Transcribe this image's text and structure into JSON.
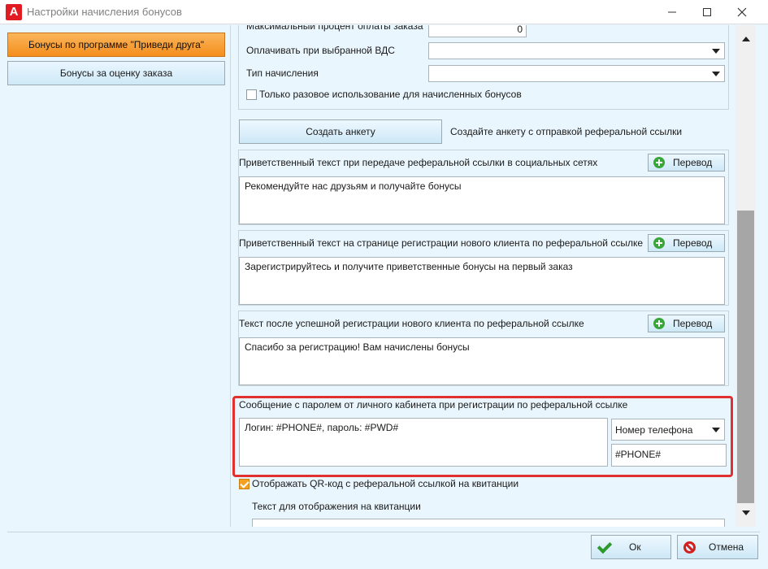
{
  "window": {
    "title": "Настройки начисления бонусов",
    "app_icon_letter": "A"
  },
  "sidebar": {
    "items": [
      {
        "label": "Бонусы по программе \"Приведи друга\"",
        "active": true
      },
      {
        "label": "Бонусы за оценку заказа",
        "active": false
      }
    ]
  },
  "form": {
    "max_percent_label": "Максимальный процент оплаты заказа",
    "max_percent_value": "0",
    "pay_vds_label": "Оплачивать при выбранной ВДС",
    "pay_vds_value": "",
    "accrual_type_label": "Тип начисления",
    "accrual_type_value": "",
    "one_time_label": "Только разовое использование для начисленных бонусов",
    "create_button": "Создать анкету",
    "create_hint": "Создайте анкету с отправкой реферальной ссылки",
    "translate_label": "Перевод",
    "social_label": "Приветственный текст при передаче реферальной ссылки в социальных сетях",
    "social_text": "Рекомендуйте нас друзьям и получайте бонусы",
    "registration_label": "Приветственный текст на странице регистрации нового клиента по реферальной ссылке",
    "registration_text": "Зарегистрируйтесь и получите приветственные бонусы на первый заказ",
    "after_reg_label": "Текст после успешной регистрации нового клиента по реферальной ссылке",
    "after_reg_text": "Спасибо за регистрацию! Вам начислены бонусы",
    "password_msg_label": "Сообщение с паролем от личного кабинета при регистрации по реферальной ссылке",
    "password_msg_text": "Логин: #PHONE#, пароль: #PWD#",
    "field_select_value": "Номер телефона",
    "field_token_value": "#PHONE#",
    "show_qr_label": "Отображать QR-код с реферальной ссылкой на квитанции",
    "receipt_text_label": "Текст для отображения на квитанции"
  },
  "footer": {
    "ok_label": "Ок",
    "cancel_label": "Отмена"
  },
  "colors": {
    "accent_active": "#f48e1c",
    "highlight_border": "#e03030",
    "panel_bg": "#eaf6fd"
  }
}
